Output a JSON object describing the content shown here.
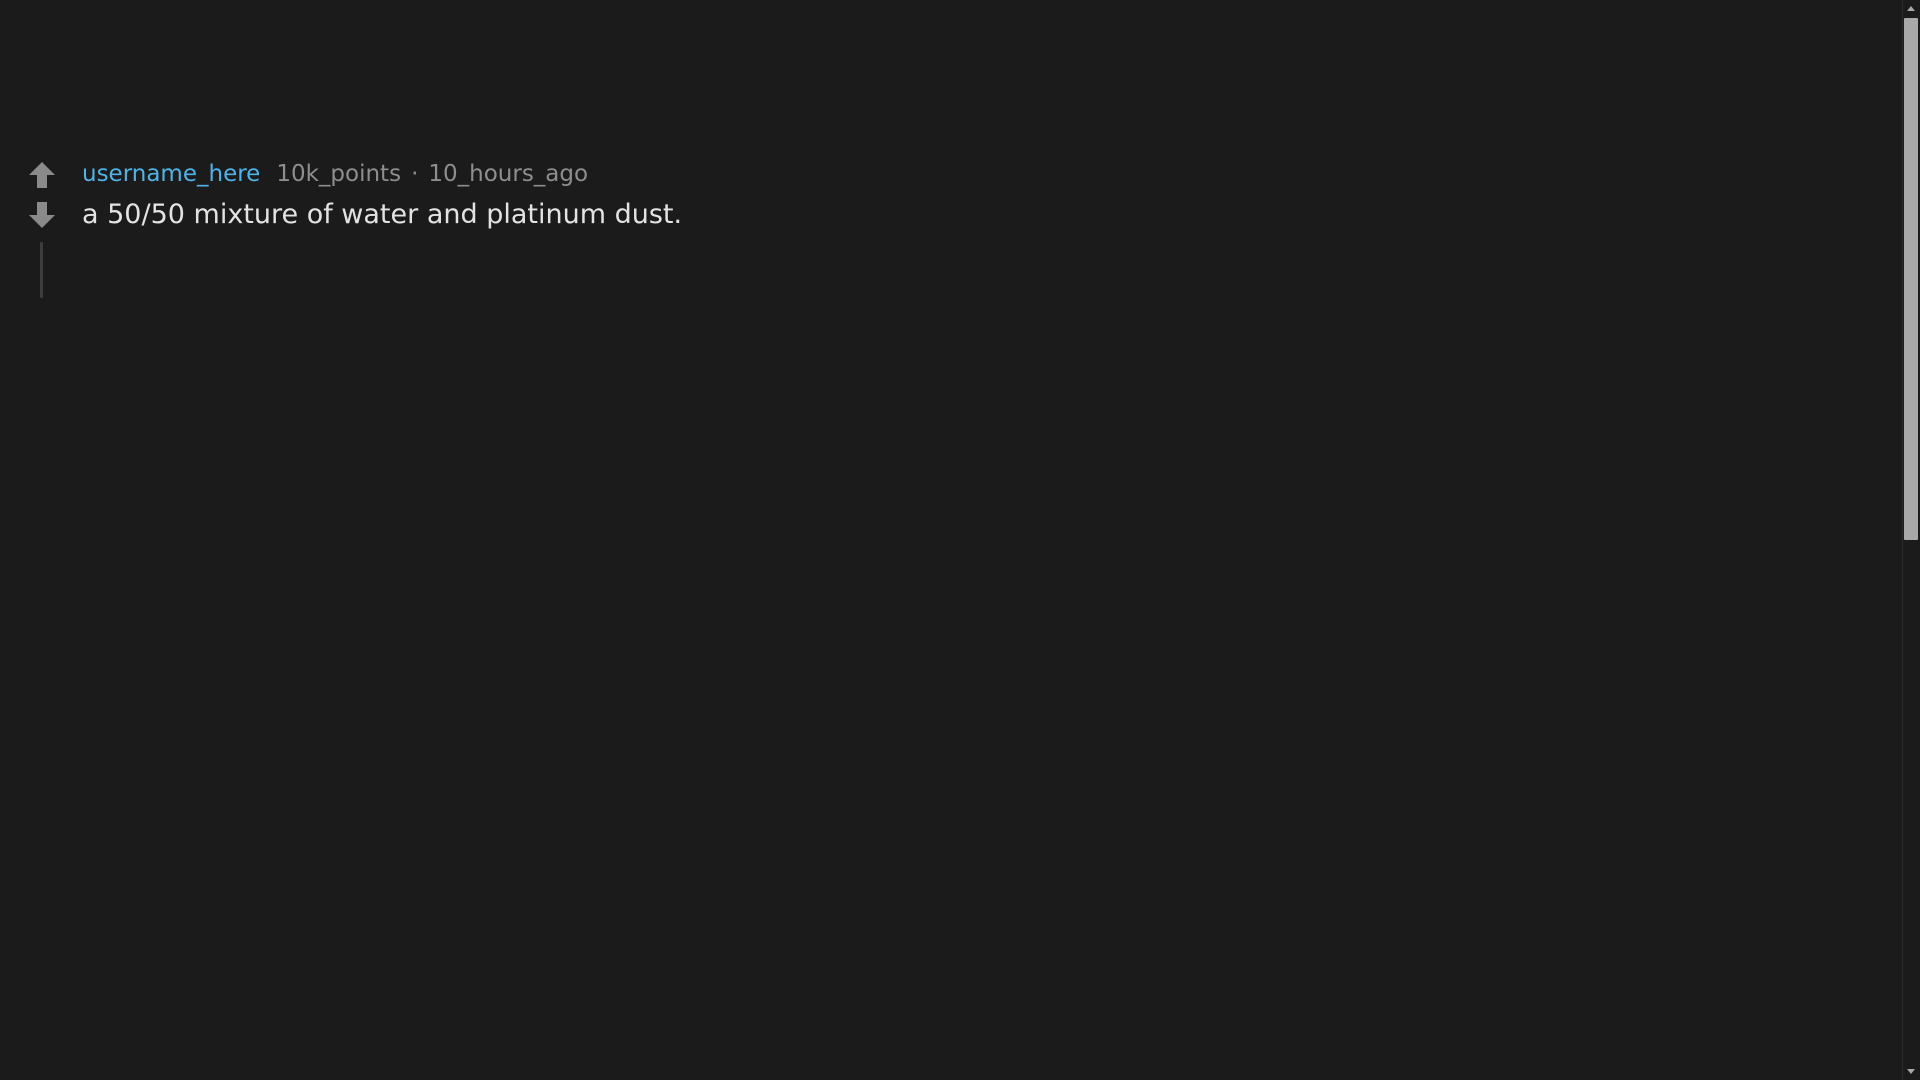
{
  "comment": {
    "username": "username_here",
    "points": "10k_points",
    "separator": "·",
    "time_ago": "10_hours_ago",
    "body": "a 50/50 mixture of water and platinum dust."
  },
  "icons": {
    "upvote": "arrow-up-icon",
    "downvote": "arrow-down-icon",
    "scroll_up": "triangle-up-icon",
    "scroll_down": "triangle-down-icon"
  },
  "colors": {
    "background": "#1b1b1b",
    "username": "#4fb3e8",
    "meta_text": "#8e8e8e",
    "body_text": "#e3e3e3",
    "vote_arrow": "#8a8a8a",
    "thread_line": "#3d3d3d",
    "scroll_thumb": "#a8a8a8"
  }
}
